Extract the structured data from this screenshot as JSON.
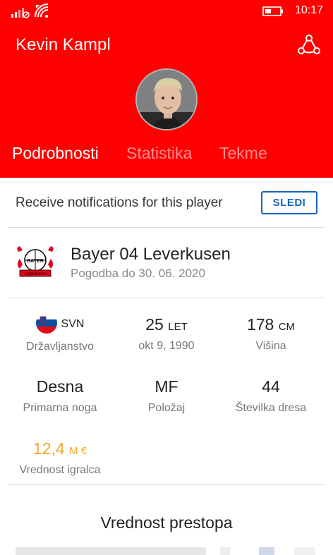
{
  "status_bar": {
    "time": "10:17",
    "icons": [
      "signal-icon",
      "wifi-icon",
      "battery-icon"
    ]
  },
  "header": {
    "player_name": "Kevin Kampl",
    "share_icon": "share-icon",
    "background_color": "#ff0000"
  },
  "tabs": [
    {
      "label": "Podrobnosti",
      "active": true
    },
    {
      "label": "Statistika",
      "active": false
    },
    {
      "label": "Tekme",
      "active": false
    }
  ],
  "notifications": {
    "text": "Receive notifications for this player",
    "follow_label": "SLEDI",
    "accent_color": "#1565c0"
  },
  "club": {
    "name": "Bayer 04 Leverkusen",
    "contract": "Pogodba do 30. 06. 2020",
    "logo_text_top": "BAYER",
    "logo_text_bottom": "Leverkusen"
  },
  "stats": {
    "nationality": {
      "value": "SVN",
      "label": "Državljanstvo"
    },
    "age": {
      "value": "25",
      "unit": "LET",
      "label": "okt 9, 1990"
    },
    "height": {
      "value": "178",
      "unit": "CM",
      "label": "Višina"
    },
    "foot": {
      "value": "Desna",
      "label": "Primarna noga"
    },
    "position": {
      "value": "MF",
      "label": "Položaj"
    },
    "shirt": {
      "value": "44",
      "label": "Številka dresa"
    },
    "market_value": {
      "value": "12,4",
      "unit": "M €",
      "label": "Vrednost igralca",
      "color": "#f5a623"
    }
  },
  "transfer": {
    "title": "Vrednost prestopa"
  }
}
